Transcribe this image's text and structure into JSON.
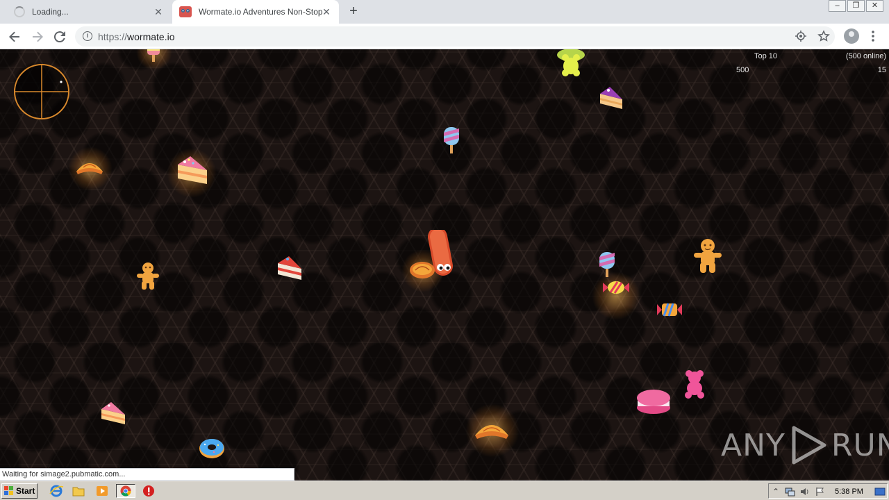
{
  "browser": {
    "tabs": [
      {
        "title": "Loading...",
        "close": "✕"
      },
      {
        "title": "Wormate.io Adventures Non-Stop",
        "close": "✕"
      }
    ],
    "new_tab": "+",
    "window_controls": [
      "–",
      "❐",
      "✕"
    ],
    "url_scheme": "https://",
    "url_host": "wormate.io",
    "status_text": "Waiting for simage2.pubmatic.com..."
  },
  "game": {
    "leaderboard_title": "Top 10",
    "online": "(500 online)",
    "score": "500",
    "count": "15"
  },
  "watermark": {
    "left": "ANY",
    "right": "RUN"
  },
  "taskbar": {
    "start_label": "Start",
    "clock": "5:38 PM"
  },
  "colors": {
    "game_bg": "#1c1412",
    "minimap_ring": "#d9892c",
    "worm": "#e5603a",
    "taskbar": "#d4d0c8"
  },
  "icons": [
    "loading-spinner-icon",
    "wormate-favicon",
    "back-icon",
    "forward-icon",
    "reload-icon",
    "info-icon",
    "location-icon",
    "star-icon",
    "profile-icon",
    "menu-icon",
    "windows-logo-icon",
    "ie-icon",
    "folder-icon",
    "media-player-icon",
    "chrome-icon",
    "stop-icon"
  ]
}
